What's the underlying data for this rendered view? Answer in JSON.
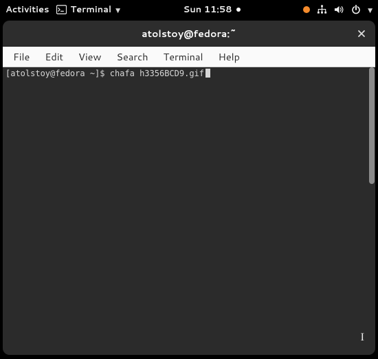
{
  "topbar": {
    "activities": "Activities",
    "app_label": "Terminal",
    "clock": "Sun 11:58"
  },
  "window": {
    "title": "atolstoy@fedora:~"
  },
  "menubar": {
    "items": [
      "File",
      "Edit",
      "View",
      "Search",
      "Terminal",
      "Help"
    ]
  },
  "terminal": {
    "prompt": "[atolstoy@fedora ~]$ ",
    "command": "chafa h3356BCD9.gif"
  }
}
